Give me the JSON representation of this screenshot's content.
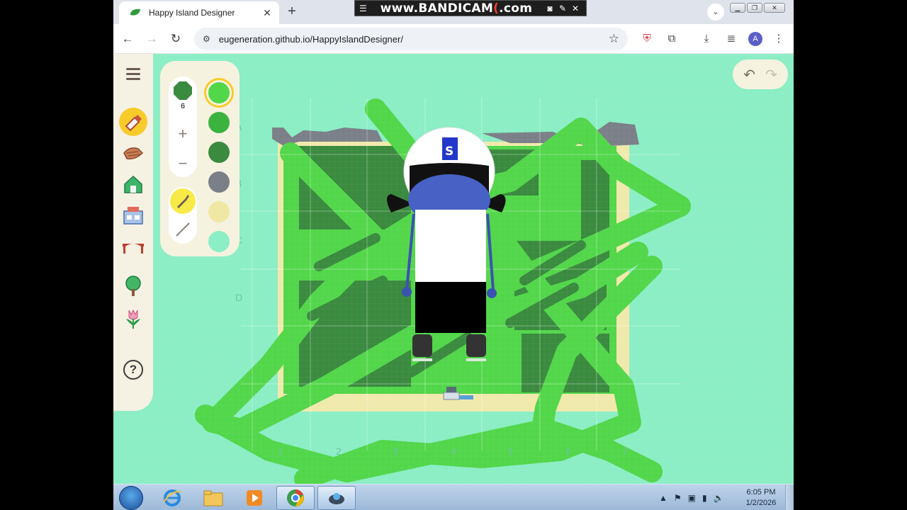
{
  "browser": {
    "tab_title": "Happy Island Designer",
    "url": "eugeneration.github.io/HappyIslandDesigner/",
    "profile_initial": "A"
  },
  "recorder": {
    "brand_prefix": "www.",
    "brand_main": "BANDICAM",
    "brand_suffix": ".com"
  },
  "palette": {
    "brush_size": "6",
    "plus_label": "+",
    "minus_label": "−",
    "colors": [
      "#52d64a",
      "#3bb33e",
      "#3a8a3f",
      "#7b7f88",
      "#efe8a4",
      "#8beec4"
    ],
    "selected_color": "#52d64a"
  },
  "grid": {
    "row_labels": [
      "A",
      "B",
      "C",
      "D"
    ],
    "col_labels": [
      "1",
      "2",
      "3",
      "4",
      "5",
      "6",
      "7"
    ]
  },
  "sidebar": {
    "items": [
      "menu-icon",
      "terrain-paint-icon",
      "path-icon",
      "building-icon",
      "shop-icon",
      "bridge-icon",
      "tree-icon",
      "flower-icon",
      "help-icon"
    ],
    "help_label": "?"
  },
  "taskbar": {
    "time": "6:05 PM",
    "date": "1/2/2026"
  },
  "colors": {
    "water": "#8beec4",
    "sand": "#f0e9ac",
    "grass": "#52d64a",
    "dark_grass": "#3a8a3f",
    "rock": "#7b7f88",
    "accent": "#f7cb2a"
  }
}
